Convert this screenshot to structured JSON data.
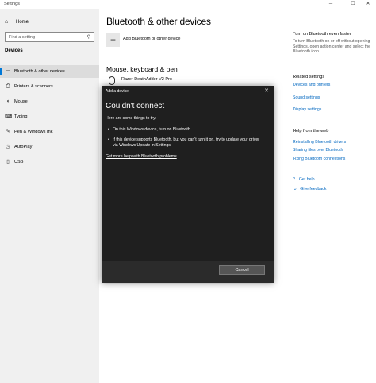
{
  "window": {
    "title": "Settings",
    "minimize": "─",
    "maximize": "☐",
    "close": "✕"
  },
  "sidebar": {
    "home": "Home",
    "search_placeholder": "Find a setting",
    "section": "Devices",
    "items": [
      {
        "label": "Bluetooth & other devices",
        "icon": "bluetooth-icon",
        "selected": true
      },
      {
        "label": "Printers & scanners",
        "icon": "printer-icon"
      },
      {
        "label": "Mouse",
        "icon": "mouse-icon"
      },
      {
        "label": "Typing",
        "icon": "keyboard-icon"
      },
      {
        "label": "Pen & Windows Ink",
        "icon": "pen-icon"
      },
      {
        "label": "AutoPlay",
        "icon": "autoplay-icon"
      },
      {
        "label": "USB",
        "icon": "usb-icon"
      }
    ]
  },
  "main": {
    "title": "Bluetooth & other devices",
    "add_label": "Add Bluetooth or other device",
    "group_title": "Mouse, keyboard & pen",
    "device_name": "Razer DeathAdder V2 Pro"
  },
  "right": {
    "tip_title": "Turn on Bluetooth even faster",
    "tip_text": "To turn Bluetooth on or off without opening Settings, open action center and select the Bluetooth icon.",
    "related_title": "Related settings",
    "related_links": [
      "Devices and printers",
      "Sound settings",
      "Display settings"
    ],
    "help_title": "Help from the web",
    "help_links": [
      "Reinstalling Bluetooth drivers",
      "Sharing files over Bluetooth",
      "Fixing Bluetooth connections"
    ],
    "get_help": "Get help",
    "give_feedback": "Give feedback"
  },
  "dialog": {
    "title": "Add a device",
    "heading": "Couldn't connect",
    "intro": "Here are some things to try:",
    "bullets": [
      "On this Windows device, turn on Bluetooth.",
      "If this device supports Bluetooth, but you can't turn it on, try to update your driver via Windows Update in Settings."
    ],
    "link": "Get more help with Bluetooth problems",
    "cancel": "Cancel"
  },
  "colors": {
    "accent": "#0078d7",
    "link": "#0067c0",
    "dialog_bg": "#1f1f1f"
  }
}
